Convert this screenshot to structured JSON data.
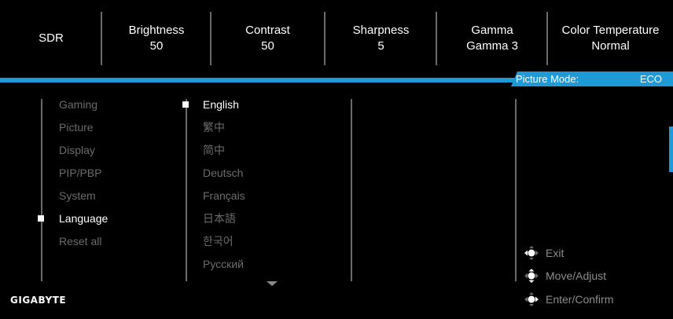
{
  "top_status": [
    {
      "label": "SDR",
      "value": ""
    },
    {
      "label": "Brightness",
      "value": "50"
    },
    {
      "label": "Contrast",
      "value": "50"
    },
    {
      "label": "Sharpness",
      "value": "5"
    },
    {
      "label": "Gamma",
      "value": "Gamma 3"
    },
    {
      "label": "Color Temperature",
      "value": "Normal"
    }
  ],
  "picture_mode": {
    "label": "Picture Mode:",
    "value": "ECO"
  },
  "main_menu": {
    "items": [
      "Gaming",
      "Picture",
      "Display",
      "PIP/PBP",
      "System",
      "Language",
      "Reset all"
    ],
    "selected": "Language"
  },
  "language_menu": {
    "items": [
      "English",
      "繁中",
      "简中",
      "Deutsch",
      "Français",
      "日本語",
      "한국어",
      "Русский"
    ],
    "selected": "English"
  },
  "help": {
    "exit": "Exit",
    "move": "Move/Adjust",
    "enter": "Enter/Confirm"
  },
  "brand": "GIGABYTE",
  "colors": {
    "accent": "#1e9ad6",
    "dim_text": "#6b6b6b",
    "background": "#000000"
  }
}
